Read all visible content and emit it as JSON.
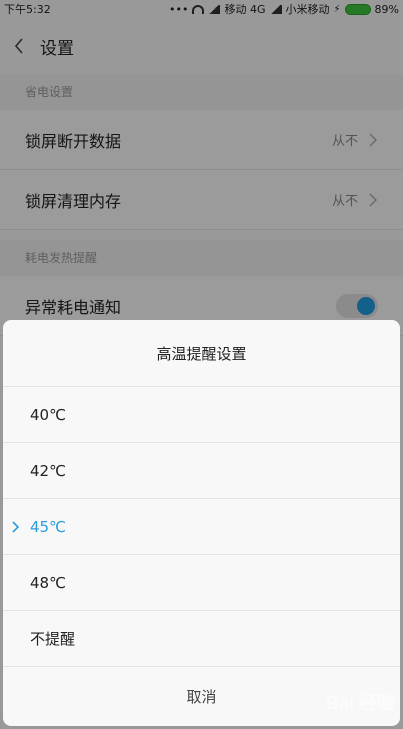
{
  "status_bar": {
    "time": "下午5:32",
    "carrier1": "移动 4G",
    "carrier2": "小米移动",
    "battery": "89%",
    "battery_color": "#3ec63e"
  },
  "header": {
    "title": "设置"
  },
  "sections": [
    {
      "header": "省电设置",
      "rows": [
        {
          "label": "锁屏断开数据",
          "value": "从不"
        },
        {
          "label": "锁屏清理内存",
          "value": "从不"
        }
      ]
    },
    {
      "header": "耗电发热提醒",
      "rows": [
        {
          "label": "异常耗电通知"
        }
      ]
    }
  ],
  "dialog": {
    "title": "高温提醒设置",
    "options": [
      "40℃",
      "42℃",
      "45℃",
      "48℃",
      "不提醒"
    ],
    "selected_index": 2,
    "selected_color": "#2a9ce0",
    "cancel_label": "取消"
  },
  "watermark": "Bai 经验"
}
